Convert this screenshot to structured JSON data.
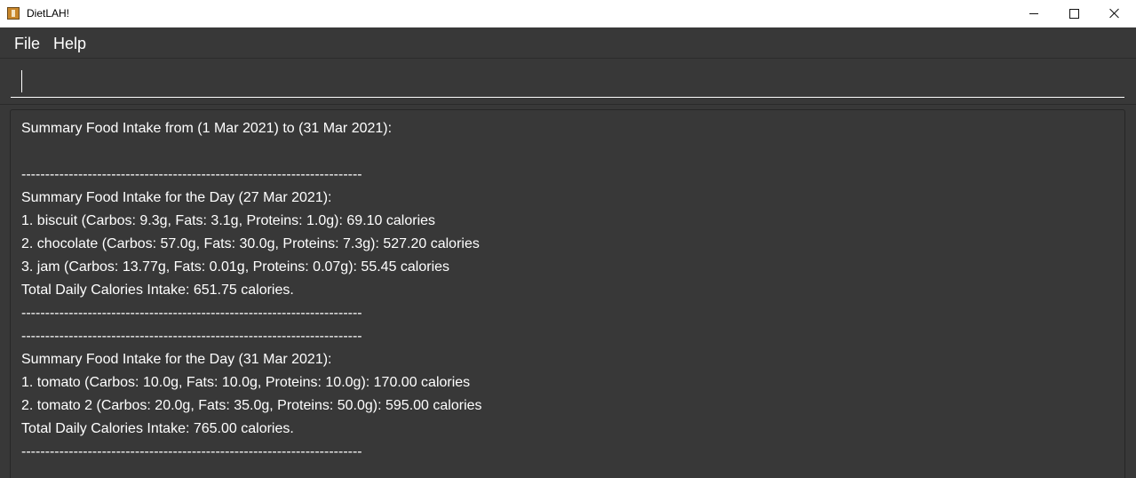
{
  "window": {
    "title": "DietLAH!",
    "icon": "app-icon",
    "controls": [
      "minimize-icon",
      "maximize-icon",
      "close-icon"
    ]
  },
  "menu": {
    "file": "File",
    "help": "Help"
  },
  "command": {
    "value": "",
    "placeholder": ""
  },
  "result": {
    "lines": [
      "Summary Food Intake from (1 Mar 2021) to (31 Mar 2021):",
      "",
      "------------------------------------------------------------------------",
      "Summary Food Intake for the Day (27 Mar 2021):",
      "1. biscuit (Carbos: 9.3g, Fats: 3.1g, Proteins: 1.0g): 69.10 calories",
      "2. chocolate (Carbos: 57.0g, Fats: 30.0g, Proteins: 7.3g): 527.20 calories",
      "3. jam (Carbos: 13.77g, Fats: 0.01g, Proteins: 0.07g): 55.45 calories",
      "Total Daily Calories Intake: 651.75 calories.",
      "------------------------------------------------------------------------",
      "------------------------------------------------------------------------",
      "Summary Food Intake for the Day (31 Mar 2021):",
      "1. tomato (Carbos: 10.0g, Fats: 10.0g, Proteins: 10.0g): 170.00 calories",
      "2. tomato 2 (Carbos: 20.0g, Fats: 35.0g, Proteins: 50.0g): 595.00 calories",
      "Total Daily Calories Intake: 765.00 calories.",
      "------------------------------------------------------------------------"
    ]
  },
  "colors": {
    "background": "#383838",
    "text": "#ffffff",
    "titlebar": "#ffffff"
  }
}
